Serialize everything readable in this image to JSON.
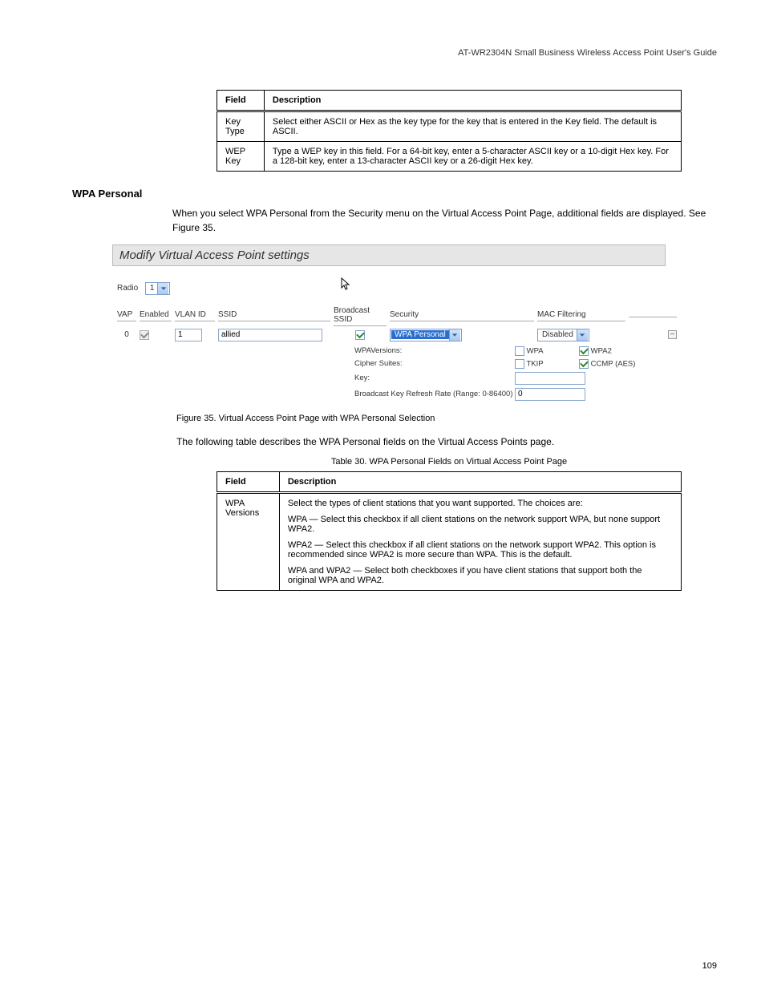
{
  "header": "AT-WR2304N Small Business Wireless Access Point User's Guide",
  "table29": {
    "header_field": "Field",
    "header_desc": "Description",
    "rows": [
      {
        "field": "Key Type",
        "desc": "Select either ASCII or Hex as the key type for the key that is entered in the Key field. The default is ASCII."
      },
      {
        "field": "WEP Key",
        "desc": "Type a WEP key in this field. For a 64-bit key, enter a 5-character ASCII key or a 10-digit Hex key. For a 128-bit key, enter a 13-character ASCII key or a 26-digit Hex key."
      }
    ]
  },
  "wpa_section": {
    "heading": "WPA Personal",
    "intro": "When you select WPA Personal from the Security menu on the Virtual Access Point Page, additional fields are displayed. See Figure 35."
  },
  "vap_panel": {
    "title": "Modify Virtual Access Point settings",
    "radio_label": "Radio",
    "radio_value": "1",
    "columns": {
      "vap": "VAP",
      "enabled": "Enabled",
      "vlan": "VLAN ID",
      "ssid": "SSID",
      "broadcast": "Broadcast SSID",
      "security": "Security",
      "mac": "MAC Filtering"
    },
    "row": {
      "vap": "0",
      "vlan": "1",
      "ssid": "allied",
      "security": "WPA Personal",
      "mac": "Disabled"
    },
    "wpa": {
      "versions_label": "WPAVersions:",
      "wpa_label": "WPA",
      "wpa2_label": "WPA2",
      "cipher_label": "Cipher Suites:",
      "tkip_label": "TKIP",
      "ccmp_label": "CCMP (AES)",
      "key_label": "Key:",
      "refresh_label": "Broadcast Key Refresh Rate (Range: 0-86400)",
      "refresh_value": "0"
    }
  },
  "figure_caption": "Figure 35. Virtual Access Point Page with WPA Personal Selection",
  "body_para": "The following table describes the WPA Personal fields on the Virtual Access Points page.",
  "table30": {
    "caption": "Table 30. WPA Personal Fields on Virtual Access Point Page",
    "header_field": "Field",
    "header_desc": "Description",
    "rows": [
      {
        "field": "WPA Versions",
        "desc_parts": [
          "Select the types of client stations that you want supported. The choices are:",
          "WPA — Select this checkbox if all client stations on the network support WPA, but none support WPA2.",
          "WPA2 — Select this checkbox if all client stations on the network support WPA2. This option is recommended since WPA2 is more secure than WPA. This is the default.",
          "WPA and WPA2 — Select both checkboxes if you have client stations that support both the original WPA and WPA2."
        ]
      }
    ]
  },
  "page_number": "109"
}
